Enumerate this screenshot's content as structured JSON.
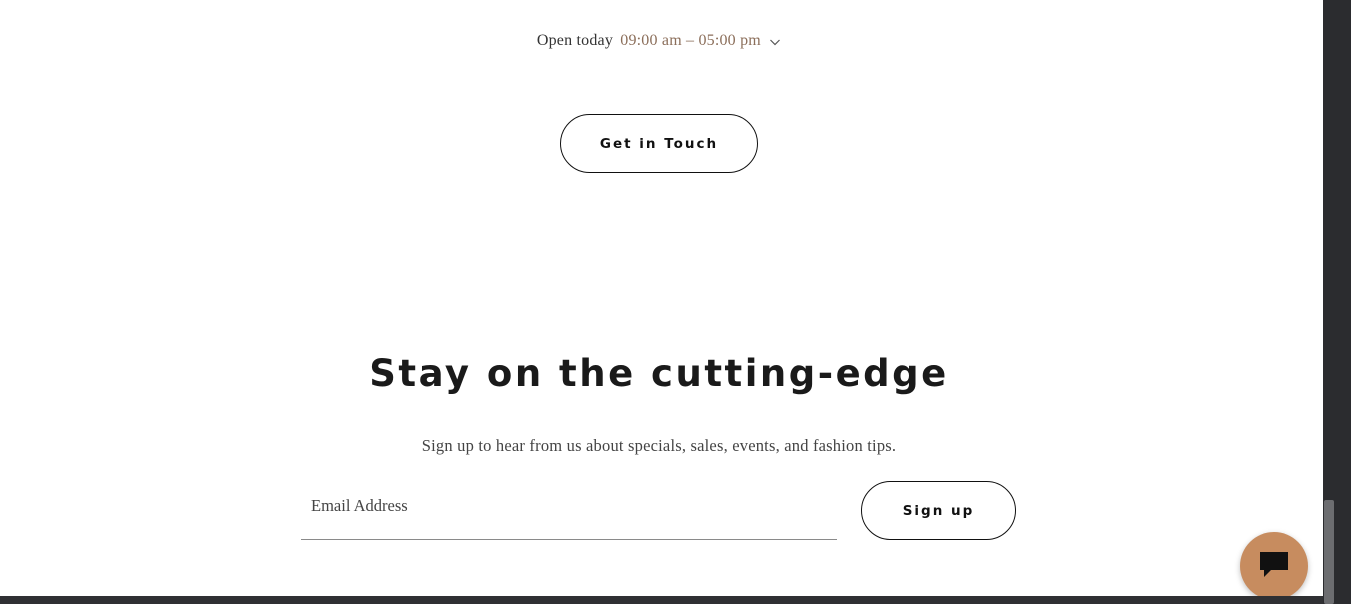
{
  "hours": {
    "label": "Open today",
    "time": "09:00 am – 05:00 pm",
    "expand_icon": "chevron-down-icon"
  },
  "contact": {
    "button_label": "Get in Touch"
  },
  "newsletter": {
    "heading": "Stay on the cutting-edge",
    "subtext": "Sign up to hear from us about specials, sales, events, and fashion tips.",
    "email_placeholder": "Email Address",
    "email_value": "",
    "submit_label": "Sign up"
  },
  "chat": {
    "icon": "chat-bubble-icon",
    "accent_color": "#c78c5f"
  },
  "colors": {
    "time_text": "#8b6e5a",
    "button_border": "#111111",
    "background": "#ffffff"
  }
}
